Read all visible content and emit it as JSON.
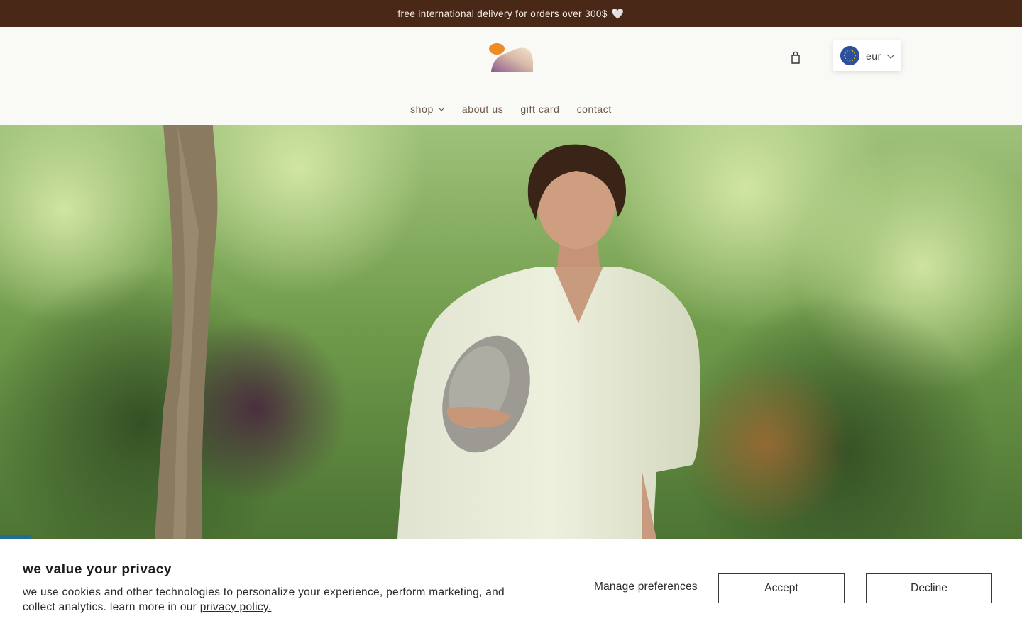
{
  "announcement": {
    "text": "free international delivery for orders over 300$",
    "emoji": "🤍"
  },
  "header": {
    "currency": {
      "code": "eur",
      "flag": "eu-flag-icon"
    }
  },
  "nav": {
    "items": [
      {
        "label": "shop",
        "has_dropdown": true
      },
      {
        "label": "about us"
      },
      {
        "label": "gift card"
      },
      {
        "label": "contact"
      }
    ]
  },
  "cookie_banner": {
    "title": "we value your privacy",
    "body": "we use cookies and other technologies to personalize your experience, perform marketing, and collect analytics. learn more in our ",
    "link": "privacy policy.",
    "manage_label": "Manage preferences",
    "accept_label": "Accept",
    "decline_label": "Decline"
  },
  "colors": {
    "announcement_bg": "#4a2818",
    "nav_text": "#6e5a4c",
    "logo_orange": "#f08a24",
    "background": "#f9f9f6"
  }
}
